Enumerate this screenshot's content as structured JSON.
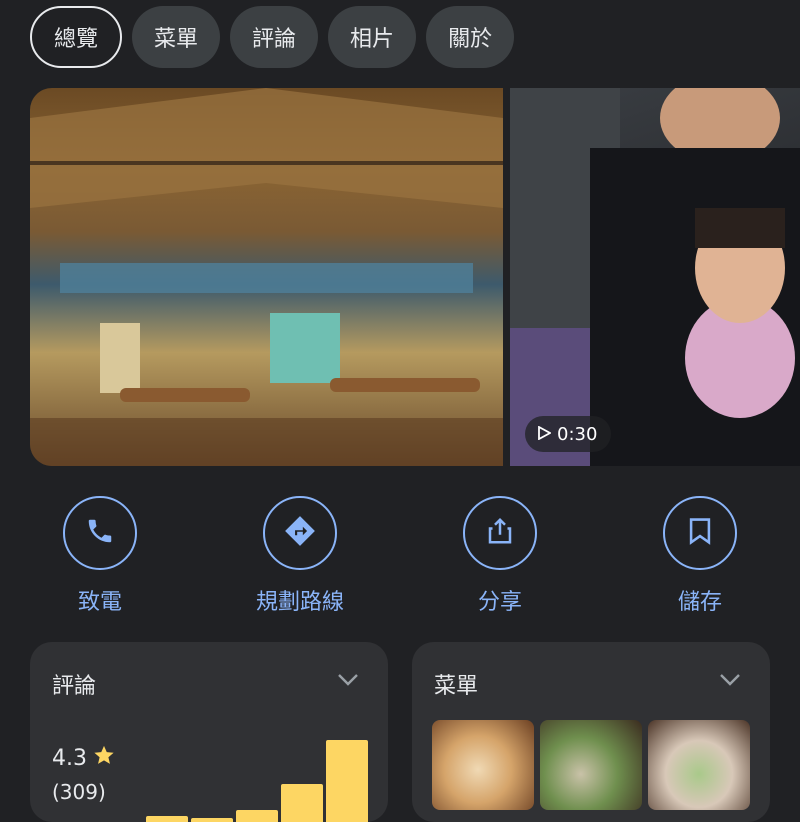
{
  "tabs": [
    "總覽",
    "菜單",
    "評論",
    "相片",
    "關於"
  ],
  "video": {
    "duration": "0:30"
  },
  "actions": [
    {
      "label": "致電",
      "icon": "phone-icon"
    },
    {
      "label": "規劃路線",
      "icon": "directions-icon"
    },
    {
      "label": "分享",
      "icon": "share-icon"
    },
    {
      "label": "儲存",
      "icon": "bookmark-icon"
    }
  ],
  "reviews": {
    "title": "評論",
    "rating": "4.3",
    "count": "(309)",
    "distribution_5_to_1": [
      1,
      0.9,
      0.8,
      0.55,
      1
    ]
  },
  "menu": {
    "title": "菜單"
  },
  "colors": {
    "accent": "#8ab4f8",
    "star": "#fdd663",
    "background": "#202124",
    "card": "#303134"
  }
}
